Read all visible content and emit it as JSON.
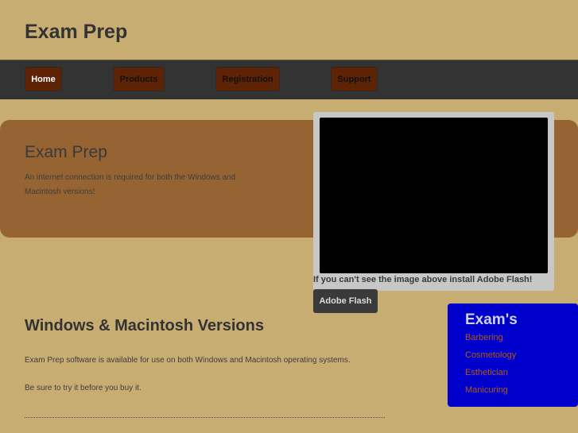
{
  "header": {
    "title": "Exam Prep"
  },
  "nav": {
    "items": [
      {
        "label": "Home",
        "active": true
      },
      {
        "label": "Products",
        "active": false
      },
      {
        "label": "Registration",
        "active": false
      },
      {
        "label": "Support",
        "active": false
      }
    ]
  },
  "hero": {
    "title": "Exam Prep",
    "text": "An internet connection is required for both the Windows and Macintosh versions!"
  },
  "flash": {
    "caption": "If you can't see the image above install Adobe Flash!",
    "button_label": "Adobe Flash"
  },
  "exams": {
    "title": "Exam's",
    "links": [
      "Barbering",
      "Cosmetology",
      "Esthetician",
      "Manicuring"
    ]
  },
  "main": {
    "title": "Windows & Macintosh Versions",
    "paragraphs": [
      "Exam Prep software is available for use on both Windows and Macintosh operating systems.",
      "Be sure to try it before you buy it."
    ]
  },
  "colors": {
    "background": "#c8ad72",
    "navbar": "#333333",
    "nav_button": "#5e2304",
    "hero": "#966332",
    "exams_box": "#0000cc",
    "exam_link": "#b0581c"
  }
}
